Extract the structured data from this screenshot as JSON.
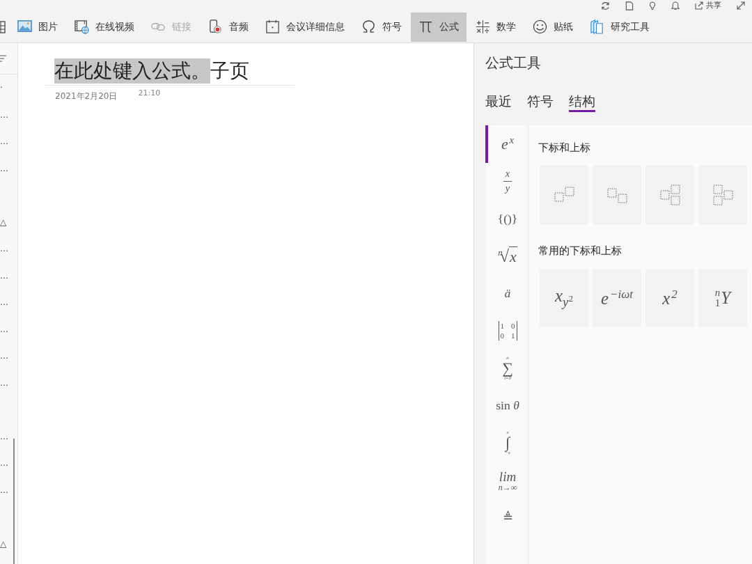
{
  "top_bar": {
    "share_label": "共享"
  },
  "ribbon": {
    "items": [
      {
        "label": "图片",
        "selected": false,
        "disabled": false
      },
      {
        "label": "在线视频",
        "selected": false,
        "disabled": false
      },
      {
        "label": "链接",
        "selected": false,
        "disabled": true
      },
      {
        "label": "音频",
        "selected": false,
        "disabled": false
      },
      {
        "label": "会议详细信息",
        "selected": false,
        "disabled": false
      },
      {
        "label": "符号",
        "selected": false,
        "disabled": false
      },
      {
        "label": "公式",
        "selected": true,
        "disabled": false
      },
      {
        "label": "数学",
        "selected": false,
        "disabled": false
      },
      {
        "label": "贴纸",
        "selected": false,
        "disabled": false
      },
      {
        "label": "研究工具",
        "selected": false,
        "disabled": false
      }
    ]
  },
  "page_list": {
    "items": [
      {
        "kind": "title",
        "text": "·"
      },
      {
        "kind": "title",
        "text": "…"
      },
      {
        "kind": "title",
        "text": "…"
      },
      {
        "kind": "title",
        "text": "…"
      },
      {
        "kind": "blank"
      },
      {
        "kind": "title",
        "text": "△"
      },
      {
        "kind": "title",
        "text": "…"
      },
      {
        "kind": "title",
        "text": "…"
      },
      {
        "kind": "title",
        "text": "…"
      },
      {
        "kind": "title",
        "text": "…"
      },
      {
        "kind": "title",
        "text": "…"
      },
      {
        "kind": "title",
        "text": "…"
      },
      {
        "kind": "blank"
      },
      {
        "kind": "title",
        "text": "…"
      },
      {
        "kind": "title",
        "text": "…"
      },
      {
        "kind": "title",
        "text": "…"
      },
      {
        "kind": "blank"
      },
      {
        "kind": "title",
        "text": "△"
      }
    ]
  },
  "page": {
    "title": [
      {
        "text": "在此处键入公式。",
        "selected": true
      },
      {
        "text": "子页",
        "selected": false
      }
    ],
    "date": "2021年2月20日",
    "time": "21:10"
  },
  "equation_panel": {
    "title": "公式工具",
    "tabs": [
      {
        "label": "最近",
        "selected": false
      },
      {
        "label": "符号",
        "selected": false
      },
      {
        "label": "结构",
        "selected": true
      }
    ],
    "categories": [
      {
        "kind": "power",
        "base": "e",
        "sup": "x",
        "selected": true
      },
      {
        "kind": "fraction",
        "num": "x",
        "den": "y",
        "selected": false
      },
      {
        "kind": "text",
        "text": "{()}",
        "selected": false
      },
      {
        "kind": "radical",
        "index": "n",
        "sign": "√",
        "radicand": "x",
        "selected": false
      },
      {
        "kind": "text",
        "text": "*ä*",
        "selected": false
      },
      {
        "kind": "matrix",
        "rows": [
          [
            "1",
            "0"
          ],
          [
            "0",
            "1"
          ]
        ],
        "selected": false
      },
      {
        "kind": "operator",
        "symbol": "∑",
        "over": "n",
        "under": "i=0",
        "selected": false
      },
      {
        "kind": "text",
        "text": "sin *θ*",
        "selected": false
      },
      {
        "kind": "operator",
        "symbol": "∫",
        "over": "x",
        "under": "−x",
        "selected": false
      },
      {
        "kind": "limit",
        "top": "lim",
        "bottom": "n→∞",
        "selected": false
      },
      {
        "kind": "text",
        "text": "≜",
        "selected": false
      }
    ],
    "sections": [
      {
        "kind": "structures",
        "heading": "下标和上标"
      },
      {
        "kind": "formulas",
        "heading": "常用的下标和上标",
        "items": [
          {
            "kind": "sub_sup",
            "base": "x",
            "sub": "y",
            "sub_sup": "2"
          },
          {
            "kind": "power",
            "base": "e",
            "sup": "−iωt"
          },
          {
            "kind": "power",
            "base": "x",
            "sup": "2"
          },
          {
            "kind": "prescript",
            "pre_sup": "n",
            "pre_sub": "1",
            "base": "Y"
          }
        ]
      }
    ]
  }
}
